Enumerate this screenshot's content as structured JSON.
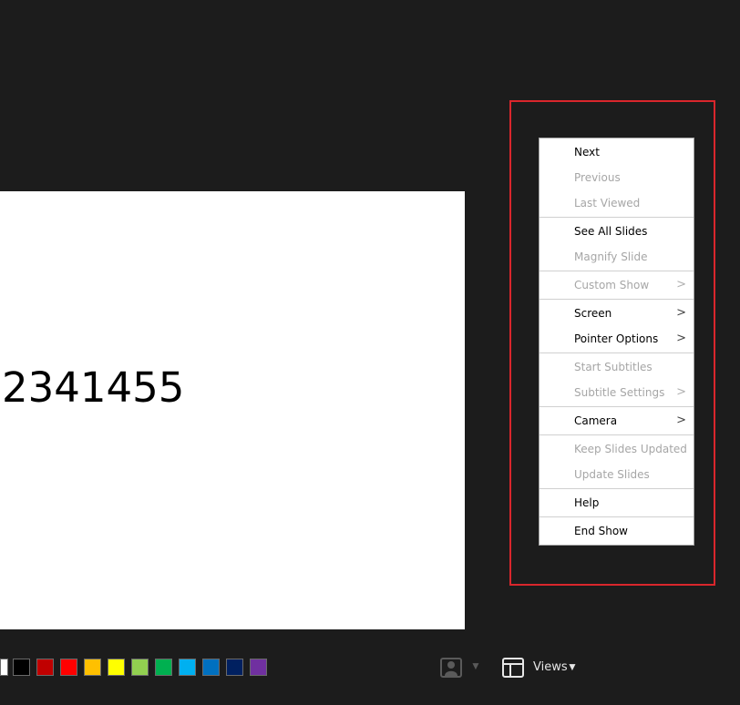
{
  "slide": {
    "text": "2341455"
  },
  "context_menu": {
    "items": [
      {
        "label": "Next",
        "enabled": true,
        "submenu": false
      },
      {
        "label": "Previous",
        "enabled": false,
        "submenu": false
      },
      {
        "label": "Last Viewed",
        "enabled": false,
        "submenu": false
      },
      {
        "label": "See All Slides",
        "enabled": true,
        "submenu": false
      },
      {
        "label": "Magnify Slide",
        "enabled": false,
        "submenu": false
      },
      {
        "label": "Custom Show",
        "enabled": false,
        "submenu": true
      },
      {
        "label": "Screen",
        "enabled": true,
        "submenu": true
      },
      {
        "label": "Pointer Options",
        "enabled": true,
        "submenu": true
      },
      {
        "label": "Start Subtitles",
        "enabled": false,
        "submenu": false
      },
      {
        "label": "Subtitle Settings",
        "enabled": false,
        "submenu": true
      },
      {
        "label": "Camera",
        "enabled": true,
        "submenu": true
      },
      {
        "label": "Keep Slides Updated",
        "enabled": false,
        "submenu": false
      },
      {
        "label": "Update Slides",
        "enabled": false,
        "submenu": false
      },
      {
        "label": "Help",
        "enabled": true,
        "submenu": false
      },
      {
        "label": "End Show",
        "enabled": true,
        "submenu": false
      }
    ],
    "submenu_glyph": ">"
  },
  "toolbar": {
    "ink_colors": [
      "#ffffff",
      "#000000",
      "#c00000",
      "#ff0000",
      "#ffc000",
      "#ffff00",
      "#92d050",
      "#00b050",
      "#00b0f0",
      "#0070c0",
      "#002060",
      "#7030a0"
    ],
    "presenter_icon": "presenter-camera-icon",
    "presenter_arrow": "▼",
    "views_icon": "views-layout-icon",
    "views_label": "Views",
    "views_arrow": "▼"
  },
  "colors": {
    "background": "#1c1c1c",
    "highlight": "#d9262c"
  }
}
